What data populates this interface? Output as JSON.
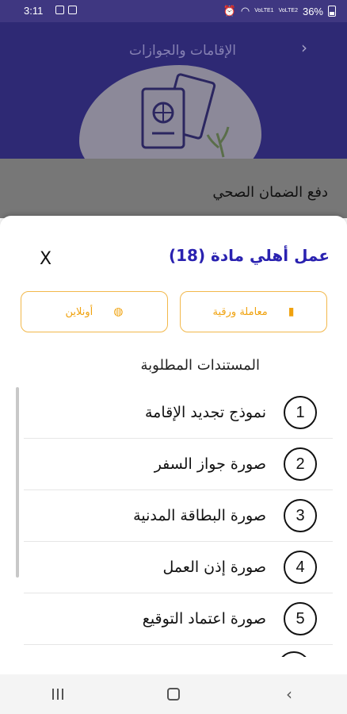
{
  "status_bar": {
    "time": "3:11",
    "battery": "36%",
    "network_1": "VoLTE1",
    "network_2": "VoLTE2"
  },
  "header": {
    "title": "الإقامات والجوازات"
  },
  "background_card": {
    "label": "دفع الضمان الصحي"
  },
  "sheet": {
    "title": "عمل أهلي مادة (18)",
    "close_label": "X",
    "options": {
      "paper": "معاملة ورقية",
      "online": "أونلاين"
    },
    "required_heading": "المستندات المطلوبة",
    "documents": [
      {
        "number": "1",
        "label": "نموذج تجديد الإقامة"
      },
      {
        "number": "2",
        "label": "صورة جواز السفر"
      },
      {
        "number": "3",
        "label": "صورة البطاقة  المدنية"
      },
      {
        "number": "4",
        "label": "صورة إذن العمل"
      },
      {
        "number": "5",
        "label": "صورة اعتماد التوقيع"
      }
    ]
  },
  "colors": {
    "header_bg": "#2e2974",
    "title_blue": "#2a22b0",
    "accent_orange": "#f0a20e",
    "option_border": "#f2b84b"
  }
}
